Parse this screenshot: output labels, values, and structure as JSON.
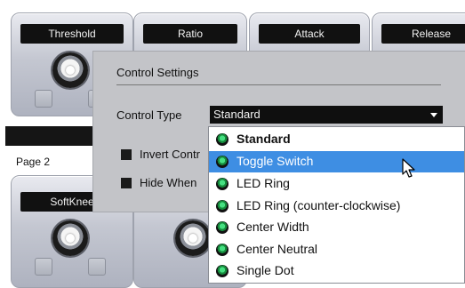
{
  "panels": {
    "threshold": "Threshold",
    "ratio": "Ratio",
    "attack": "Attack",
    "release": "Release",
    "softknee": "SoftKnee"
  },
  "page_label": "Page 2",
  "dialog": {
    "title": "Control Settings",
    "control_type_label": "Control Type",
    "control_type_value": "Standard",
    "invert_label": "Invert Contr",
    "hide_label": "Hide When"
  },
  "dropdown": {
    "options": [
      "Standard",
      "Toggle Switch",
      "LED Ring",
      "LED Ring (counter-clockwise)",
      "Center Width",
      "Center Neutral",
      "Single Dot"
    ],
    "selected_index": 1,
    "current_index": 0
  },
  "icons": {
    "knob": "rotary-knob-icon",
    "option": "led-dot-icon",
    "cursor": "mouse-pointer-icon"
  },
  "colors": {
    "highlight": "#3e8ee3",
    "led_green": "#2fcf6a",
    "dialog_bg": "#c3c4c8"
  }
}
